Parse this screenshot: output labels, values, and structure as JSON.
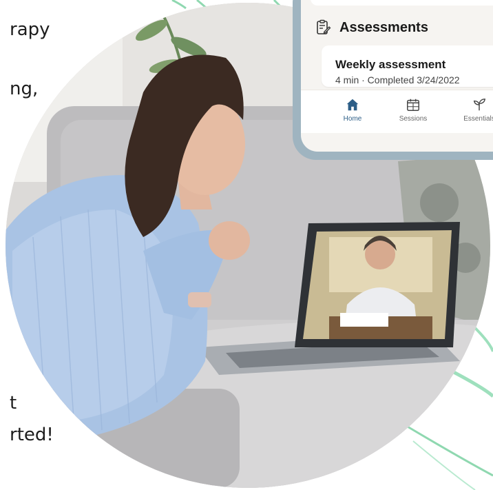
{
  "left_text": {
    "line1": "rapy",
    "line2": "ng,",
    "line3": "t",
    "line4": "rted!"
  },
  "phone": {
    "section_title": "Assessments",
    "section_icon": "clipboard-icon",
    "card": {
      "title": "Weekly assessment",
      "meta": "4 min · Completed 3/24/2022"
    },
    "nav": [
      {
        "label": "Home",
        "icon": "home-icon",
        "active": true
      },
      {
        "label": "Sessions",
        "icon": "calendar-icon",
        "active": false
      },
      {
        "label": "Essentials",
        "icon": "sprout-icon",
        "active": false
      }
    ]
  },
  "colors": {
    "accent_green": "#7fd3a6",
    "nav_active": "#2d5e87",
    "phone_frame": "#9fb4c0"
  }
}
